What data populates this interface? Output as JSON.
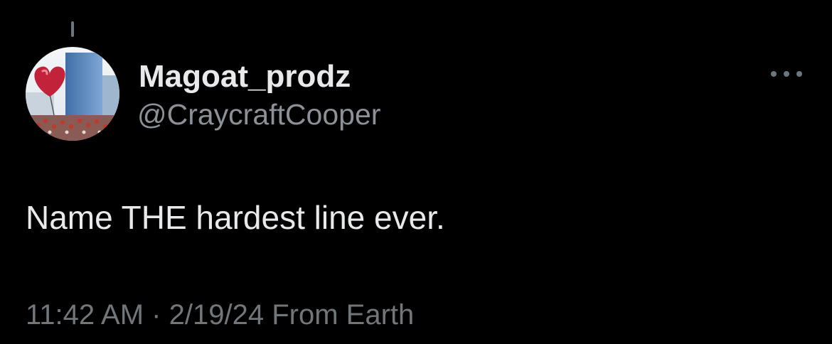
{
  "tweet": {
    "display_name": "Magoat_prodz",
    "handle": "@CraycraftCooper",
    "text": "Name THE hardest line ever.",
    "time": "11:42 AM",
    "separator": "·",
    "date": "2/19/24",
    "source": "From Earth"
  },
  "icons": {
    "more": "more-horizontal-icon",
    "avatar": "heart-balloon-avatar"
  },
  "colors": {
    "background": "#000000",
    "primary_text": "#e7e9ea",
    "secondary_text": "#71767b"
  }
}
